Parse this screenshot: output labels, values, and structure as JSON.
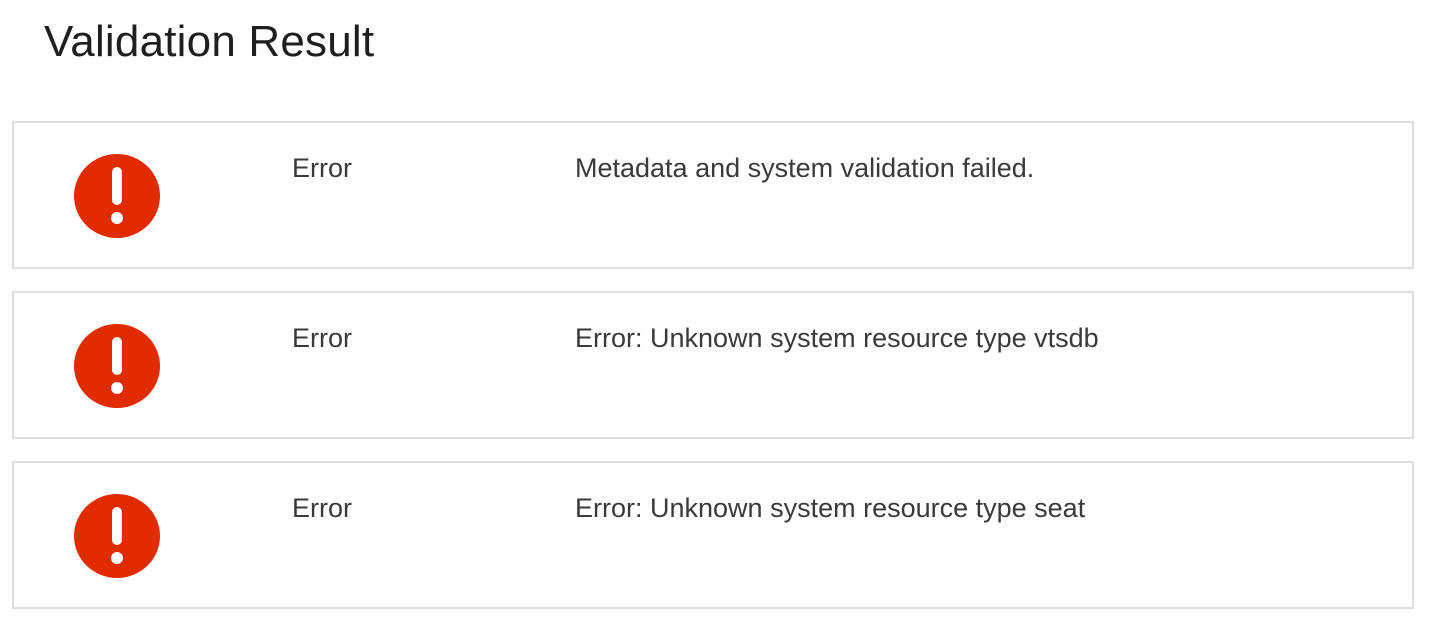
{
  "page": {
    "title": "Validation Result"
  },
  "colors": {
    "error": "#e12b00",
    "border": "#dedede",
    "text": "#3a3a3a"
  },
  "results": [
    {
      "icon": "error-icon",
      "severity": "Error",
      "message": "Metadata and system validation failed."
    },
    {
      "icon": "error-icon",
      "severity": "Error",
      "message": "Error: Unknown system resource type vtsdb"
    },
    {
      "icon": "error-icon",
      "severity": "Error",
      "message": "Error: Unknown system resource type seat"
    }
  ]
}
